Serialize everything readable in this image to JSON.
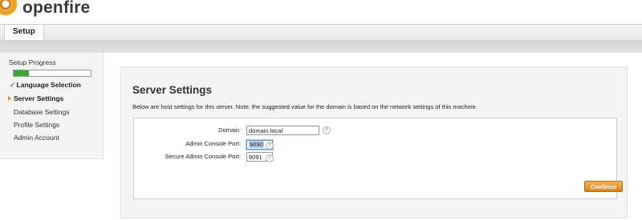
{
  "header": {
    "brand": "openfire",
    "brand_mark": "™"
  },
  "tabs": [
    {
      "label": "Setup"
    }
  ],
  "sidebar": {
    "progress_label": "Setup Progress",
    "progress_fraction": 0.2,
    "items": [
      {
        "label": "Language Selection",
        "state": "done"
      },
      {
        "label": "Server Settings",
        "state": "current"
      },
      {
        "label": "Database Settings",
        "state": "pending"
      },
      {
        "label": "Profile Settings",
        "state": "pending"
      },
      {
        "label": "Admin Account",
        "state": "pending"
      }
    ]
  },
  "main": {
    "title": "Server Settings",
    "description": "Below are host settings for this server. Note: the suggested value for the domain is based on the network settings of this machine.",
    "fields": [
      {
        "label": "Domain:",
        "value": "domain.local"
      },
      {
        "label": "Admin Console Port:",
        "value": "9090"
      },
      {
        "label": "Secure Admin Console Port:",
        "value": "9091"
      }
    ],
    "continue_label": "Continue"
  },
  "colors": {
    "accent": "#e08a1e",
    "progress": "#3fa33a",
    "button": "#d9851c"
  },
  "icons": {
    "logo": "openfire-logo-icon",
    "check": "check-icon",
    "current_step": "arrow-right-icon",
    "help": "help-icon"
  }
}
